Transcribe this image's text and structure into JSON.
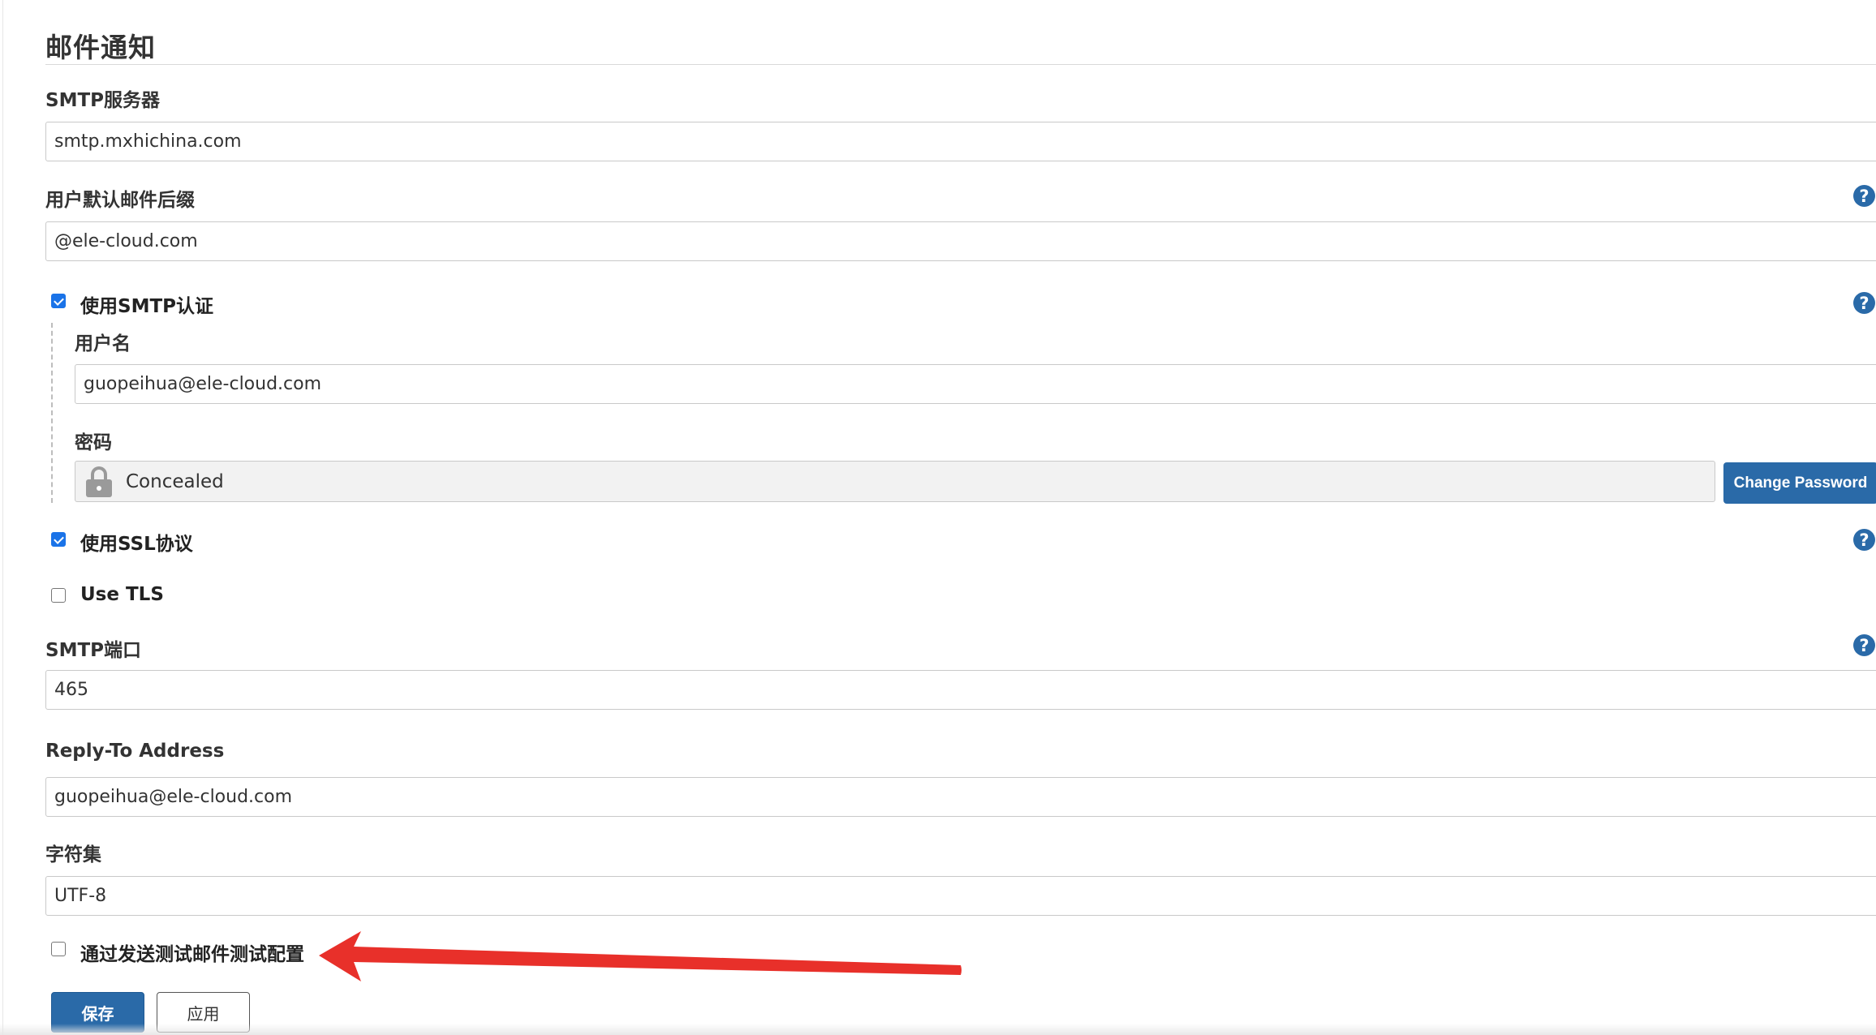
{
  "section": {
    "title": "邮件通知"
  },
  "smtp_server": {
    "label": "SMTP服务器",
    "value": "smtp.mxhichina.com"
  },
  "default_suffix": {
    "label": "用户默认邮件后缀",
    "value": "@ele-cloud.com"
  },
  "smtp_auth": {
    "label": "使用SMTP认证",
    "checked": true,
    "username": {
      "label": "用户名",
      "value": "guopeihua@ele-cloud.com"
    },
    "password": {
      "label": "密码",
      "concealed_text": "Concealed",
      "change_button": "Change Password"
    }
  },
  "use_ssl": {
    "label": "使用SSL协议",
    "checked": true
  },
  "use_tls": {
    "label": "Use TLS",
    "checked": false
  },
  "smtp_port": {
    "label": "SMTP端口",
    "value": "465"
  },
  "reply_to": {
    "label": "Reply-To Address",
    "value": "guopeihua@ele-cloud.com"
  },
  "charset": {
    "label": "字符集",
    "value": "UTF-8"
  },
  "test_config": {
    "label": "通过发送测试邮件测试配置",
    "checked": false
  },
  "buttons": {
    "save": "保存",
    "apply": "应用"
  },
  "help_glyph": "?",
  "icons": [
    "help-icon",
    "lock-icon",
    "arrow-annotation"
  ],
  "colors": {
    "primary": "#2a6aa8",
    "checkbox": "#1a73e8",
    "annotation": "#e8302a"
  }
}
